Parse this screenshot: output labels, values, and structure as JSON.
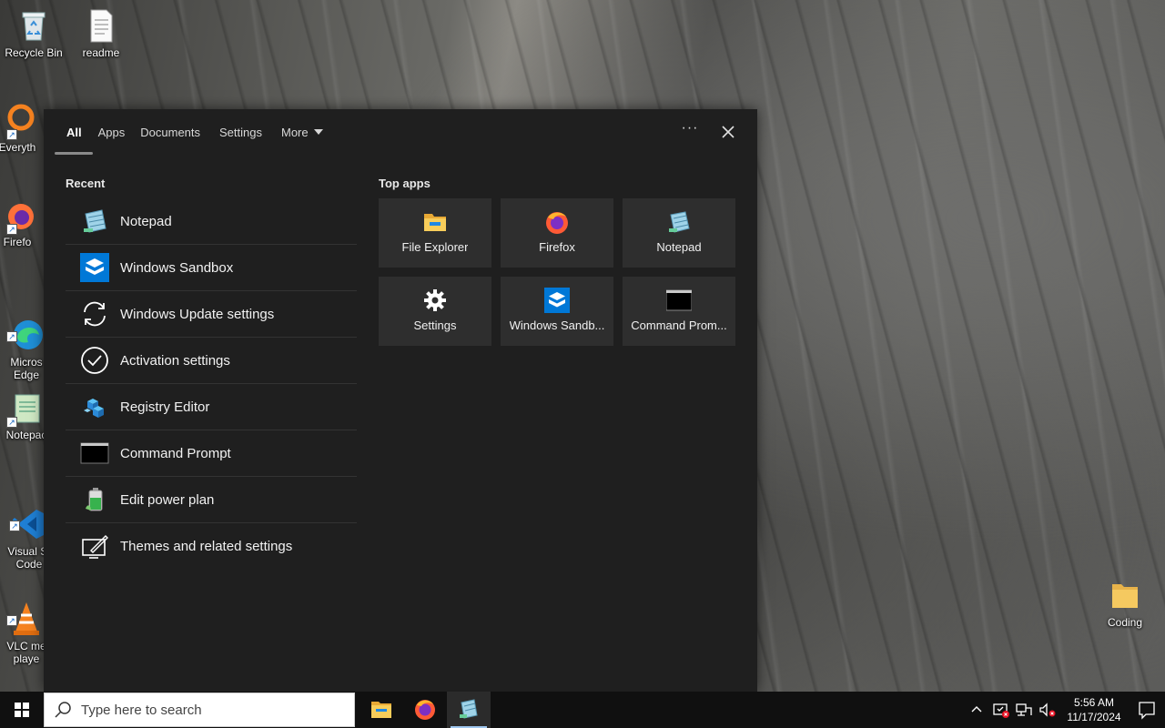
{
  "desktop": {
    "icons": [
      {
        "label": "Recycle Bin"
      },
      {
        "label": "readme"
      },
      {
        "label": "Everyth"
      },
      {
        "label": "Firefo"
      },
      {
        "label": "Micros\nEdge"
      },
      {
        "label": "Notepac"
      },
      {
        "label": "Visual St\nCode"
      },
      {
        "label": "VLC me\nplaye"
      },
      {
        "label": "Coding"
      }
    ]
  },
  "search_panel": {
    "tabs": [
      {
        "label": "All"
      },
      {
        "label": "Apps"
      },
      {
        "label": "Documents"
      },
      {
        "label": "Settings"
      },
      {
        "label": "More"
      }
    ],
    "options_glyph": "···",
    "recent_title": "Recent",
    "recent_items": [
      {
        "label": "Notepad",
        "icon": "notepad-icon"
      },
      {
        "label": "Windows Sandbox",
        "icon": "sandbox-icon"
      },
      {
        "label": "Windows Update settings",
        "icon": "update-icon"
      },
      {
        "label": "Activation settings",
        "icon": "activation-icon"
      },
      {
        "label": "Registry Editor",
        "icon": "registry-icon"
      },
      {
        "label": "Command Prompt",
        "icon": "cmd-icon"
      },
      {
        "label": "Edit power plan",
        "icon": "battery-icon"
      },
      {
        "label": "Themes and related settings",
        "icon": "themes-icon"
      }
    ],
    "top_apps_title": "Top apps",
    "top_apps": [
      {
        "label": "File Explorer",
        "icon": "folder-icon"
      },
      {
        "label": "Firefox",
        "icon": "firefox-icon"
      },
      {
        "label": "Notepad",
        "icon": "notepad-icon"
      },
      {
        "label": "Settings",
        "icon": "gear-icon"
      },
      {
        "label": "Windows Sandb...",
        "icon": "sandbox-icon"
      },
      {
        "label": "Command Prom...",
        "icon": "cmd-icon"
      }
    ]
  },
  "taskbar": {
    "search_placeholder": "Type here to search",
    "time": "5:56 AM",
    "date": "11/17/2024"
  },
  "colors": {
    "panel_bg": "#1f1f1f",
    "tile_bg": "#2e2e2e",
    "taskbar_bg": "#101010",
    "accent": "#0078d7"
  }
}
